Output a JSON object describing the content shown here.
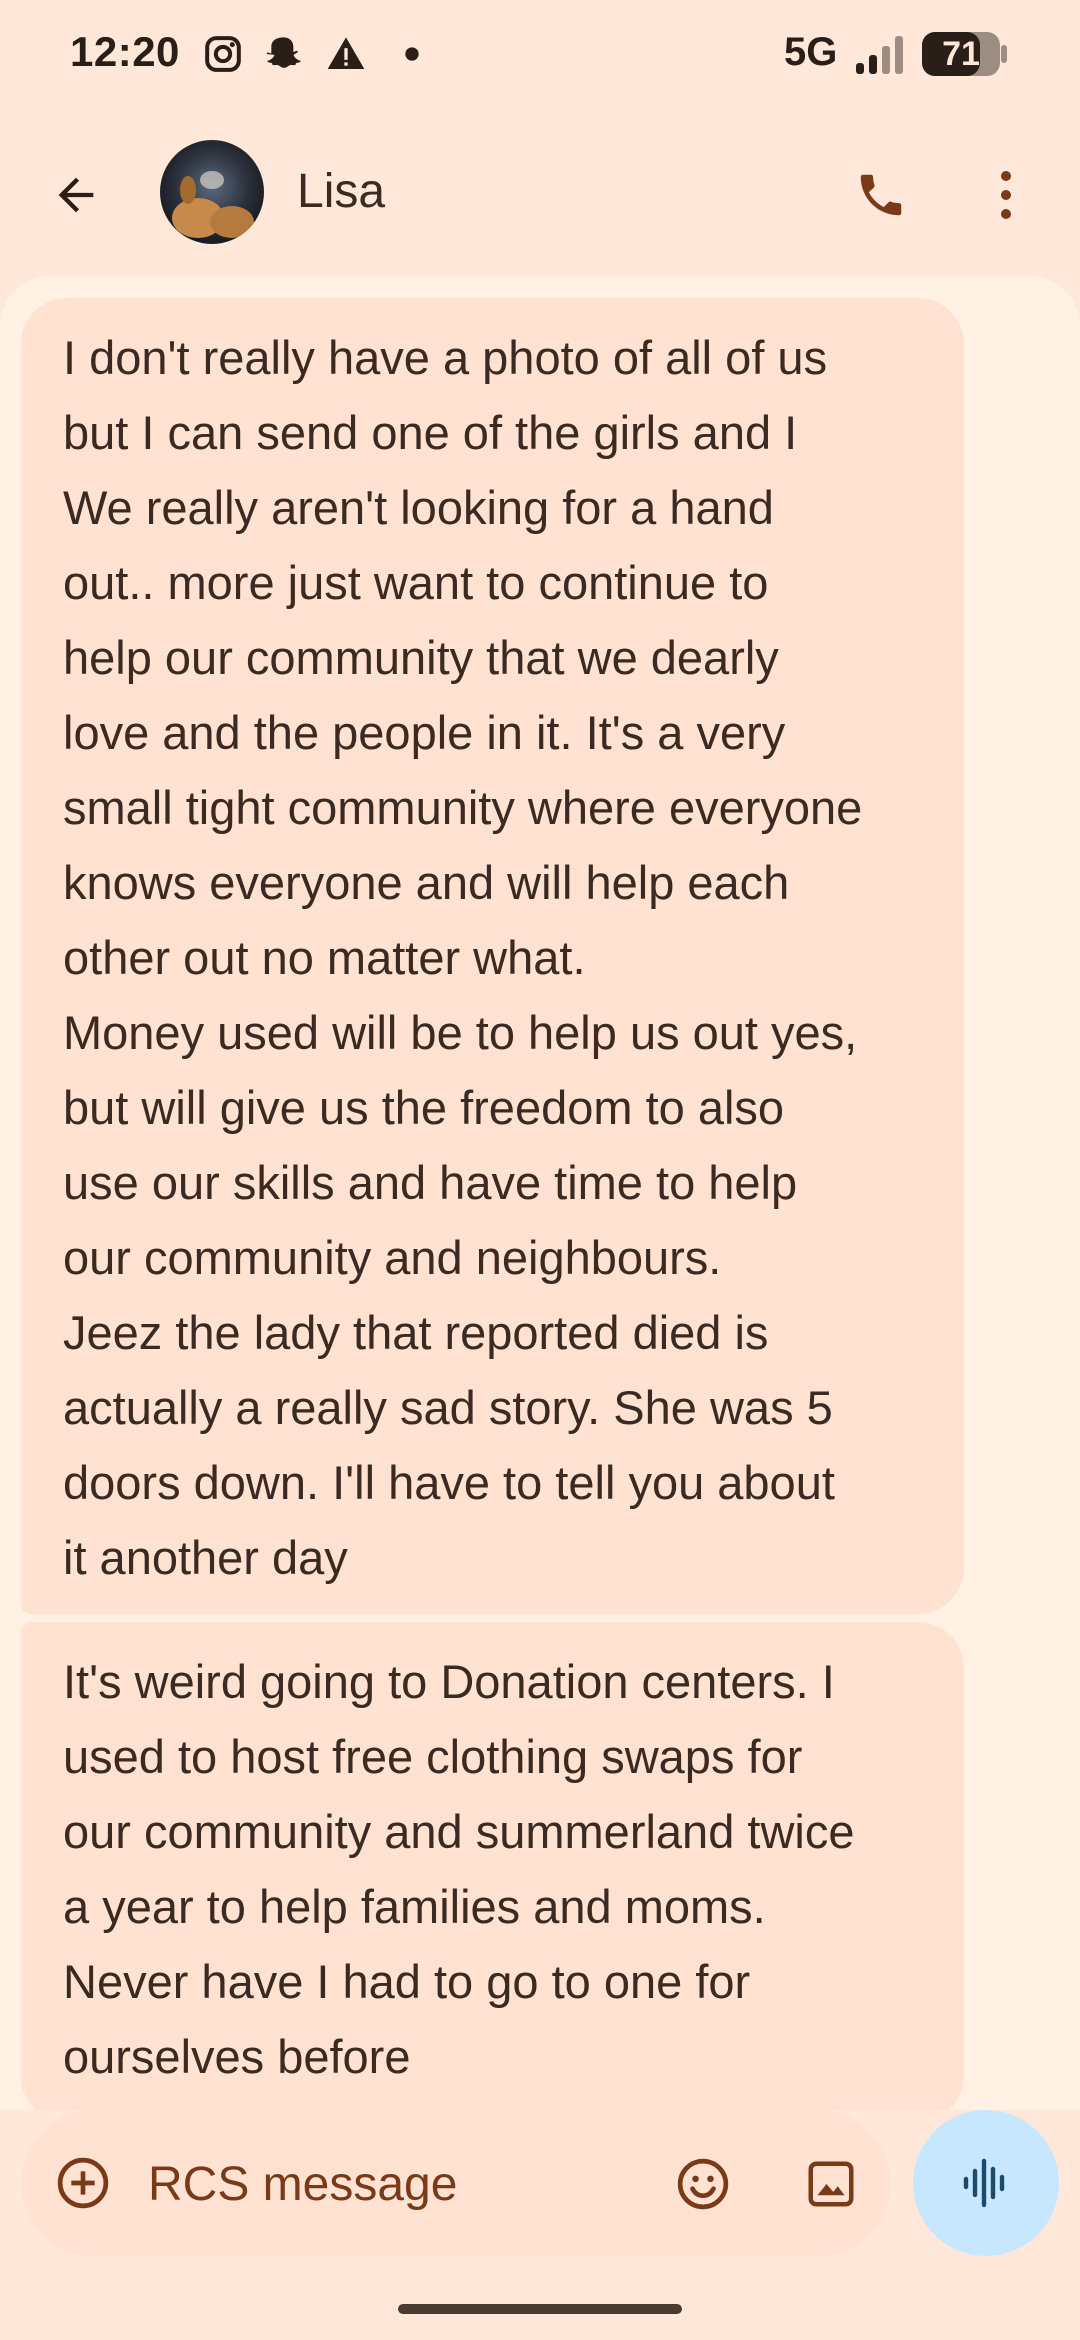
{
  "status_bar": {
    "time": "12:20",
    "network": "5G",
    "battery": "71",
    "icons": [
      "instagram-icon",
      "snapchat-icon",
      "alert-icon",
      "dot-icon",
      "signal-icon",
      "battery-icon"
    ]
  },
  "header": {
    "contact_name": "Lisa",
    "icons": [
      "back-arrow-icon",
      "avatar",
      "phone-icon",
      "more-vert-icon"
    ]
  },
  "messages": [
    {
      "text": "I don't really have a photo of all of us\nbut I can send one of the girls and I\nWe really aren't looking for a hand\nout.. more just want to continue to\nhelp our community that we dearly\nlove and the people in it. It's a very\nsmall tight community where everyone\nknows everyone and will help each\nother out no matter what.\nMoney used will be to help us out yes,\nbut will give us the freedom to also\nuse our skills and have time to help\nour community and neighbours.\nJeez the lady that reported died is\nactually a really sad story. She was 5\ndoors down. I'll have to tell you about\nit another day"
    },
    {
      "text": "It's weird going to Donation centers. I\nused to host free clothing swaps for\nour community and summerland twice\na year to help families and moms.\nNever have I had to go to one for\nourselves before"
    }
  ],
  "compose": {
    "placeholder": "RCS message",
    "value": ""
  },
  "colors": {
    "background": "#ffe8d9",
    "panel": "#fff1e4",
    "bubble": "#ffe2d1",
    "accent": "#7a3a18",
    "voice_button": "#c6e7ff"
  }
}
